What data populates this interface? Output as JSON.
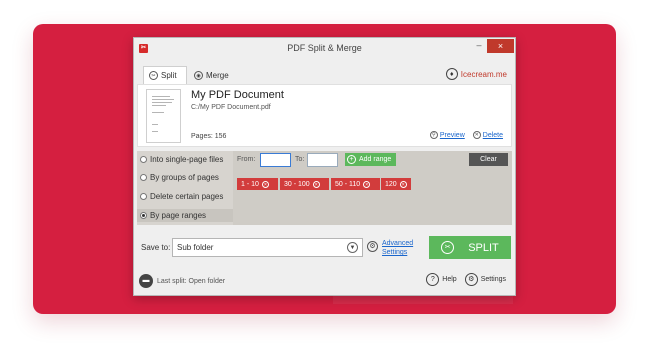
{
  "window": {
    "title": "PDF Split & Merge",
    "minimize": "–",
    "close": "×"
  },
  "tabs": [
    {
      "label": "Split",
      "icon": "scissors-icon",
      "active": true
    },
    {
      "label": "Merge",
      "icon": "merge-icon",
      "active": false
    }
  ],
  "brand": {
    "label": "Icecream.me",
    "icon": "icecream-logo-icon"
  },
  "document": {
    "title": "My PDF Document",
    "path": "C:/My PDF Document.pdf",
    "pages": "Pages: 156",
    "preview_label": "Preview",
    "delete_label": "Delete"
  },
  "split_modes": [
    {
      "label": "Into single-page files",
      "selected": false
    },
    {
      "label": "By groups of pages",
      "selected": false
    },
    {
      "label": "Delete certain pages",
      "selected": false
    },
    {
      "label": "By page ranges",
      "selected": true
    }
  ],
  "range": {
    "from_label": "From:",
    "from_value": "",
    "to_label": "To:",
    "to_value": "",
    "add_label": "Add range",
    "clear_label": "Clear",
    "chips": [
      "1 - 10",
      "30 - 100",
      "50 - 110",
      "120"
    ]
  },
  "save": {
    "label": "Save to:",
    "value": "Sub folder",
    "advanced_line1": "Advanced",
    "advanced_line2": "Settings",
    "split_label": "SPLIT"
  },
  "footer": {
    "last_split": "Last split: Open folder",
    "help_label": "Help",
    "settings_label": "Settings"
  },
  "colors": {
    "banner": "#d51f40",
    "split_button": "#5cb85c",
    "chip": "#d23c3c",
    "close_button": "#c0392b"
  }
}
